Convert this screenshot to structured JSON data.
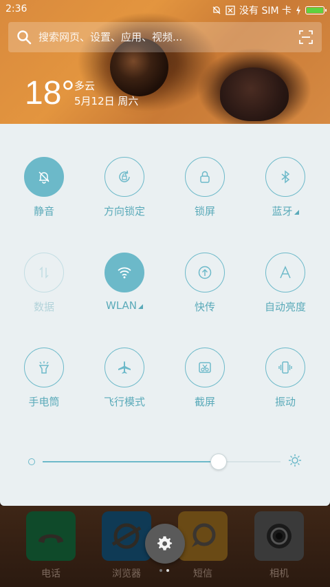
{
  "status_bar": {
    "time": "2:36",
    "carrier_text": "没有 SIM 卡",
    "battery_level_fraction": 1.0,
    "battery_color": "#5ed13f",
    "icons": [
      "mute-icon",
      "close-box-icon",
      "charging-icon",
      "battery-icon"
    ]
  },
  "search": {
    "placeholder": "搜索网页、设置、应用、视频..."
  },
  "weather": {
    "temperature": "18°",
    "condition": "多云",
    "date": "5月12日 周六"
  },
  "toggles": [
    {
      "label": "静音",
      "state": "on",
      "icon": "bell-mute-icon"
    },
    {
      "label": "方向锁定",
      "state": "off",
      "icon": "rotation-lock-icon"
    },
    {
      "label": "锁屏",
      "state": "off",
      "icon": "lock-icon"
    },
    {
      "label": "蓝牙",
      "state": "off",
      "icon": "bluetooth-icon",
      "has_more": true
    },
    {
      "label": "数据",
      "state": "disabled",
      "icon": "data-icon"
    },
    {
      "label": "WLAN",
      "state": "on",
      "icon": "wifi-icon",
      "has_more": true
    },
    {
      "label": "快传",
      "state": "off",
      "icon": "transfer-icon"
    },
    {
      "label": "自动亮度",
      "state": "off",
      "icon": "auto-brightness-icon"
    },
    {
      "label": "手电筒",
      "state": "off",
      "icon": "flashlight-icon"
    },
    {
      "label": "飞行模式",
      "state": "off",
      "icon": "airplane-icon"
    },
    {
      "label": "截屏",
      "state": "off",
      "icon": "screenshot-icon"
    },
    {
      "label": "振动",
      "state": "off",
      "icon": "vibrate-icon"
    }
  ],
  "brightness": {
    "level_fraction": 0.74,
    "accent": "#6cb9c9"
  },
  "dock": {
    "apps": [
      {
        "label": "电话",
        "icon": "phone-icon"
      },
      {
        "label": "浏览器",
        "icon": "browser-icon"
      },
      {
        "label": "短信",
        "icon": "message-icon"
      },
      {
        "label": "相机",
        "icon": "camera-icon"
      }
    ],
    "page_indicator": {
      "current": 2,
      "total": 2
    }
  },
  "colors": {
    "accent": "#6cb9c9",
    "panel_bg": "#eaf0f2"
  }
}
